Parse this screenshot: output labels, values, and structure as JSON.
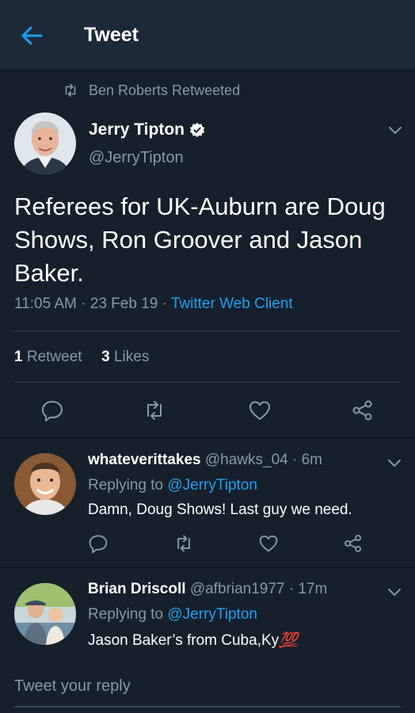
{
  "header": {
    "title": "Tweet"
  },
  "retweet_banner": {
    "text": "Ben Roberts Retweeted"
  },
  "tweet": {
    "name": "Jerry Tipton",
    "handle": "@JerryTipton",
    "text": "Referees for UK-Auburn are Doug Shows, Ron Groover and Jason Baker.",
    "time": "11:05 AM · 23 Feb 19 · ",
    "source": "Twitter Web Client",
    "retweet_count": "1",
    "retweet_label": " Retweet",
    "like_count": "3",
    "like_label": " Likes"
  },
  "replies": [
    {
      "name": "whateverittakes",
      "handle": " @hawks_04 · 6m",
      "replying_prefix": "Replying to ",
      "replying_to": "@JerryTipton",
      "text": "Damn, Doug Shows! Last guy we need."
    },
    {
      "name": "Brian Driscoll",
      "handle": " @afbrian1977 · 17m",
      "replying_prefix": "Replying to ",
      "replying_to": "@JerryTipton",
      "text": "Jason Baker’s from Cuba,Ky",
      "emoji": "💯"
    }
  ],
  "compose": {
    "placeholder": "Tweet your reply"
  },
  "colors": {
    "background": "#15202b",
    "header": "#1c2938",
    "accent": "#1da1f2",
    "muted": "#8899a6",
    "divider": "#38444d"
  }
}
